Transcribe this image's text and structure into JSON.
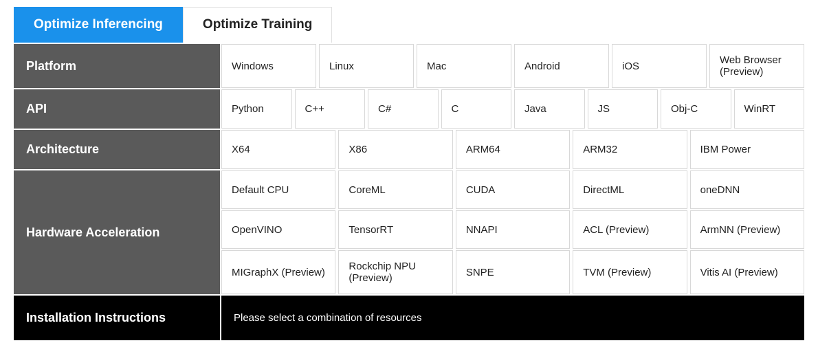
{
  "tabs": {
    "inferencing": "Optimize Inferencing",
    "training": "Optimize Training"
  },
  "rows": {
    "platform": {
      "label": "Platform",
      "options": [
        "Windows",
        "Linux",
        "Mac",
        "Android",
        "iOS",
        "Web Browser (Preview)"
      ]
    },
    "api": {
      "label": "API",
      "options": [
        "Python",
        "C++",
        "C#",
        "C",
        "Java",
        "JS",
        "Obj-C",
        "WinRT"
      ]
    },
    "architecture": {
      "label": "Architecture",
      "options": [
        "X64",
        "X86",
        "ARM64",
        "ARM32",
        "IBM Power"
      ]
    },
    "hw": {
      "label": "Hardware Acceleration",
      "row1": [
        "Default CPU",
        "CoreML",
        "CUDA",
        "DirectML",
        "oneDNN"
      ],
      "row2": [
        "OpenVINO",
        "TensorRT",
        "NNAPI",
        "ACL (Preview)",
        "ArmNN (Preview)"
      ],
      "row3": [
        "MIGraphX (Preview)",
        "Rockchip NPU (Preview)",
        "SNPE",
        "TVM (Preview)",
        "Vitis AI (Preview)"
      ]
    },
    "install": {
      "label": "Installation Instructions",
      "message": "Please select a combination of resources"
    }
  }
}
